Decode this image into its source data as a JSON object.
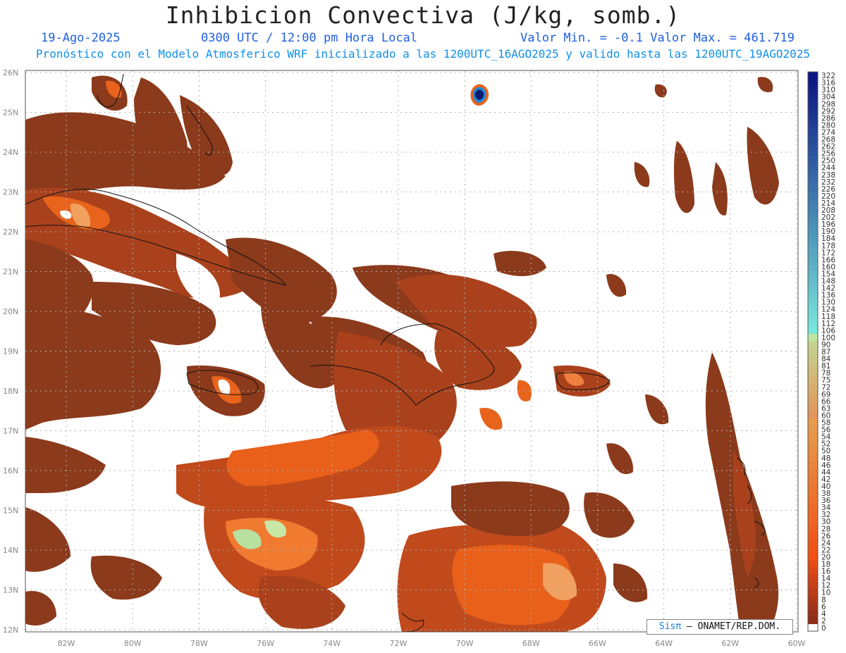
{
  "title": "Inhibicion Convectiva (J/kg, somb.)",
  "date": "19-Ago-2025",
  "time": "0300 UTC / 12:00 pm Hora Local",
  "minmax": "Valor Min. = -0.1  Valor Max. = 461.719",
  "subtitle": "Pronóstico con el Modelo Atmosferico WRF inicializado a las 1200UTC_16AGO2025 y valido hasta las  1200UTC_19AGO2025",
  "lat_labels": [
    "26N",
    "25N",
    "24N",
    "23N",
    "22N",
    "21N",
    "20N",
    "19N",
    "18N",
    "17N",
    "16N",
    "15N",
    "14N",
    "13N",
    "12N"
  ],
  "lon_labels": [
    "82W",
    "80W",
    "78W",
    "76W",
    "74W",
    "72W",
    "70W",
    "68W",
    "66W",
    "64W",
    "62W",
    "60W"
  ],
  "colorbar_labels": [
    "322",
    "316",
    "310",
    "304",
    "298",
    "292",
    "286",
    "280",
    "274",
    "268",
    "262",
    "256",
    "250",
    "244",
    "238",
    "232",
    "226",
    "220",
    "214",
    "208",
    "202",
    "196",
    "190",
    "184",
    "178",
    "172",
    "166",
    "160",
    "154",
    "148",
    "142",
    "136",
    "130",
    "124",
    "118",
    "112",
    "106",
    "100",
    "90",
    "87",
    "84",
    "81",
    "78",
    "75",
    "72",
    "69",
    "66",
    "63",
    "60",
    "58",
    "56",
    "54",
    "52",
    "50",
    "48",
    "46",
    "44",
    "42",
    "40",
    "38",
    "36",
    "34",
    "32",
    "30",
    "28",
    "26",
    "24",
    "22",
    "20",
    "18",
    "16",
    "14",
    "12",
    "10",
    "8",
    "6",
    "4",
    "2",
    "0"
  ],
  "credit": {
    "sis": "Sisπ",
    "rest": "– ONAMET/REP.DOM."
  },
  "colors": {
    "low": "#8b3a1c",
    "mid": "#e8601a",
    "high": "#f0a060",
    "peak": "#b8e0a0",
    "blue": "#0a1a80"
  }
}
